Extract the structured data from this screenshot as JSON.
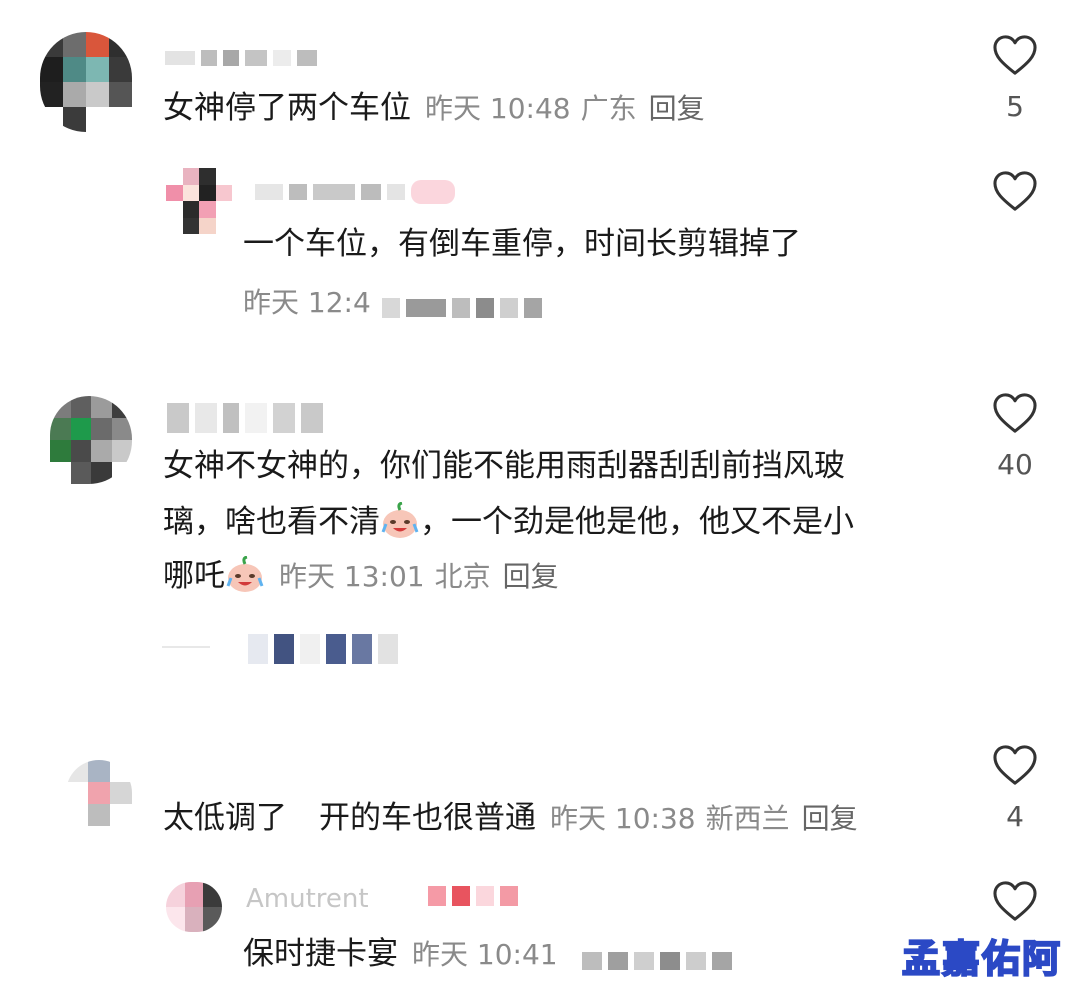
{
  "comments": [
    {
      "text": "女神停了两个车位",
      "time": "昨天 10:48",
      "location": "广东",
      "reply_label": "回复",
      "likes": "5",
      "replies": [
        {
          "text": "一个车位，有倒车重停，时间长剪辑掉了",
          "time": "昨天 12:4"
        }
      ]
    },
    {
      "text_line1": "女神不女神的，你们能不能用雨刮器刮刮前挡风玻",
      "text_line2_a": "璃，啥也看不清",
      "text_line2_b": "，一个劲是他是他，他又不是小",
      "text_line3": "哪吒",
      "time": "昨天 13:01",
      "location": "北京",
      "reply_label": "回复",
      "likes": "40"
    },
    {
      "text_a": "太低调了",
      "text_b": "开的车也很普通",
      "time": "昨天 10:38",
      "location": "新西兰",
      "reply_label": "回复",
      "likes": "4",
      "replies": [
        {
          "username_partial": "Amutrent",
          "text": "保时捷卡宴",
          "time": "昨天 10:41"
        }
      ]
    }
  ],
  "emoji_name": "crying-laughing-emoji",
  "watermark": "孟嘉佑阿",
  "colors": {
    "meta": "#8a8a8a",
    "heart_stroke": "#333333",
    "watermark_stroke": "#2b49c5"
  }
}
